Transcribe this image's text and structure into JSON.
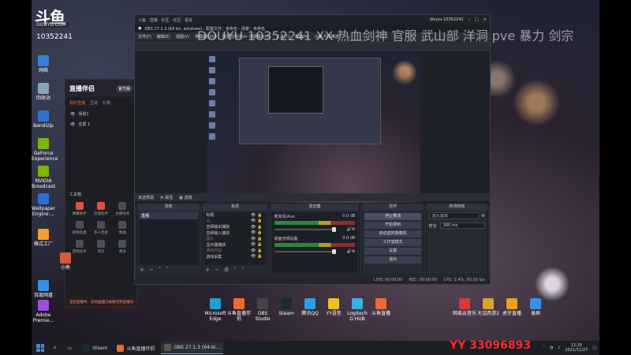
{
  "watermark": {
    "logo_text": "斗鱼",
    "logo_sub": "DOUYU.COM",
    "room_id": "10352241",
    "stream_title": "DOUYU-10352241 XX 热血剑神 官服 武山部 洋洞 pve 暴力 剑宗",
    "channel_code": "YY 33096893"
  },
  "desktop_icons_left": [
    {
      "label": "网络",
      "color": "#3b7fd6"
    },
    {
      "label": "回收站",
      "color": "#8fa3b8"
    },
    {
      "label": "Bandizip",
      "color": "#2f73d1"
    },
    {
      "label": "GeForce Experience",
      "color": "#76b900"
    },
    {
      "label": "NVIDIA Broadcast",
      "color": "#76b900"
    },
    {
      "label": "Wallpaper Engine:...",
      "color": "#2a6fd6"
    },
    {
      "label": "格式工厂",
      "color": "#f0a030"
    },
    {
      "label": "小熊",
      "color": "#d65b3b"
    },
    {
      "label": "百度网盘",
      "color": "#3a8ee6"
    },
    {
      "label": "Adobe Premie...",
      "color": "#9a4ee0"
    }
  ],
  "desktop_icons_bottom": [
    {
      "label": "Microsoft Edge",
      "color": "#1f9fd6"
    },
    {
      "label": "斗鱼直播伴侣",
      "color": "#f06a30"
    },
    {
      "label": "OBS Studio",
      "color": "#444"
    },
    {
      "label": "Steam",
      "color": "#1b2838"
    },
    {
      "label": "腾讯QQ",
      "color": "#2a9fe0"
    },
    {
      "label": "YY语音",
      "color": "#f0c020"
    },
    {
      "label": "Logitech G HUB",
      "color": "#3ab0e0"
    },
    {
      "label": "斗鱼直播",
      "color": "#f06a30"
    }
  ],
  "desktop_icons_right": [
    {
      "label": "网易云音乐",
      "color": "#e0343a"
    },
    {
      "label": "大话西游2",
      "color": "#e0a030"
    },
    {
      "label": "虎牙直播",
      "color": "#f0a020"
    },
    {
      "label": "录屏",
      "color": "#3a8ee6"
    }
  ],
  "companion": {
    "title": "直播伴侣",
    "version": "官方版",
    "tabs": [
      "我的直播",
      "互动",
      "礼物"
    ],
    "scene_label": "场景1",
    "scene_label2": "全屏 1",
    "toolbox_title": "工具箱",
    "tools": [
      "弹幕助手",
      "房管助手",
      "主播任务",
      "视频连麦",
      "多人连麦",
      "数据",
      "游戏任务",
      "音乐",
      "更多"
    ],
    "bottom_notice": "当前直播中，您的画面已被推流到直播间"
  },
  "obs": {
    "title_left": "斗鱼 · 直播 · 社区 · 社区 · 看友",
    "window_title": "OBS 27.1.3 (64 bit, windows) - 配置文件：未命名 - 场景：未命名",
    "user_name": "douyu 10352241",
    "menu": [
      "文件(F)",
      "编辑(E)",
      "视图(V)",
      "停靠窗口(D)",
      "配置文件(P)",
      "场景集合(S)",
      "工具(T)",
      "帮助(H)",
      "斗鱼-TSS推流"
    ],
    "sub_left": "未选择源",
    "sub_props": "属性",
    "sub_filters": "滤镜",
    "docks": {
      "scenes": {
        "title": "场景",
        "items": [
          "直播"
        ]
      },
      "sources": {
        "title": "来源",
        "items": [
          {
            "name": "标题",
            "dim": false
          },
          {
            "name": "日",
            "dim": true
          },
          {
            "name": "音频输出捕获",
            "dim": false
          },
          {
            "name": "音频输入捕获",
            "dim": false
          },
          {
            "name": "图片",
            "dim": true
          },
          {
            "name": "显示器捕获",
            "dim": false
          },
          {
            "name": "游戏开始",
            "dim": true
          },
          {
            "name": "游戏采集",
            "dim": false
          }
        ]
      },
      "mixer": {
        "title": "混音器",
        "channels": [
          {
            "name": "麦克风/Aux",
            "db": "0.0 dB"
          },
          {
            "name": "桌面音频设备",
            "db": "0.0 dB"
          }
        ]
      },
      "controls": {
        "title": "控件",
        "buttons": [
          "停止推流",
          "开始录制",
          "启动虚拟摄像机",
          "工作室模式",
          "设置",
          "退出"
        ]
      },
      "transitions": {
        "title": "转场特效",
        "type": "淡入淡出",
        "duration_label": "时长",
        "duration": "300 ms"
      }
    },
    "status": [
      "LIVE: 00:00:00",
      "REC: 00:00:00",
      "CPU: 2.4%, 60.00 fps"
    ]
  },
  "taskbar": {
    "items": [
      {
        "label": "Steam",
        "color": "#1b2838",
        "active": false
      },
      {
        "label": "斗鱼直播伴侣",
        "color": "#f06a30",
        "active": false
      },
      {
        "label": "OBS 27.1.3 (64-bi...",
        "color": "#555",
        "active": true
      }
    ],
    "time": "12:25",
    "date": "2021/11/27"
  }
}
